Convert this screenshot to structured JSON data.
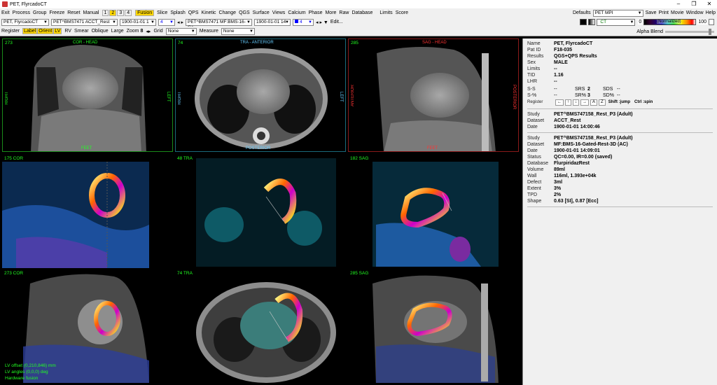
{
  "title": "PET, FlyrcadoCT",
  "window_controls": {
    "minimize": "–",
    "restore": "❐",
    "close": "✕"
  },
  "menu": [
    "Exit",
    "Process",
    "Group",
    "Freeze",
    "Reset",
    "Manual"
  ],
  "frame_numbers": [
    "1",
    "2",
    "3",
    "4"
  ],
  "fusion": "Fusion",
  "menu2": [
    "Slice",
    "Splash",
    "QPS",
    "Kinetic",
    "Change",
    "QGS",
    "Surface",
    "Views",
    "Calcium",
    "Phase",
    "More",
    "Raw",
    "Database"
  ],
  "menu3": [
    "Limits",
    "Score"
  ],
  "right_menu": {
    "defaults_label": "Defaults",
    "defaults_value": "PET MPI",
    "items": [
      "Save",
      "Print",
      "Movie",
      "Window",
      "Help"
    ]
  },
  "toolbar2": {
    "patient": "PET, FlyrcadoCT",
    "dataset1": "PET^BMS7471",
    "dataset1b": "ACCT_Rest",
    "date1": "1900-01-01 1",
    "frame1": "4",
    "dataset2": "PET^BMS7471",
    "dataset2b": "MF:BMS-16-Ga",
    "date2": "1900-01-01 14",
    "frame2": "4",
    "edit": "Edit..."
  },
  "colormap": {
    "ct": "CT",
    "min": "0",
    "max": "100",
    "label": "(Normalized)"
  },
  "toolbar3": {
    "register": "Register",
    "toggles": [
      {
        "t": "Label",
        "on": true
      },
      {
        "t": "Orient",
        "on": true
      },
      {
        "t": "LV",
        "on": true
      }
    ],
    "items": [
      "RV",
      "Smear",
      "Oblique",
      "Large"
    ],
    "zoom_label": "Zoom",
    "zoom_value": "8",
    "grid_label": "Grid",
    "grid_value": "None",
    "measure_label": "Measure",
    "measure_value": "None",
    "alpha_label": "Alpha Blend"
  },
  "viewports": {
    "r1": [
      {
        "num": "273",
        "top": "COR - HEAD",
        "left": "RIGHT",
        "right": "LEFT",
        "bottom": "FEET"
      },
      {
        "num": "74",
        "top": "TRA - ANTERIOR",
        "left": "RIGHT",
        "right": "LEFT",
        "bottom": "POSTERIOR"
      },
      {
        "num": "285",
        "top": "SAG - HEAD",
        "left": "ANTERIOR",
        "right": "POSTERIOR",
        "bottom": "FEET"
      }
    ],
    "r2": [
      "175 COR",
      "48 TRA",
      "182 SAG"
    ],
    "r3": [
      "273 COR",
      "74 TRA",
      "285 SAG"
    ],
    "footer": [
      "LV offset (0,210,846) mm",
      "LV angles (0,0,0) deg",
      "Hardware fusion"
    ]
  },
  "patient_info": [
    {
      "k": "Name",
      "v": "PET, FlyrcadoCT"
    },
    {
      "k": "Pat ID",
      "v": "F18-035"
    },
    {
      "k": "Results",
      "v": "QGS+QPS Results"
    },
    {
      "k": "Sex",
      "v": "MALE"
    },
    {
      "k": "Limits",
      "v": "--"
    },
    {
      "k": "TID",
      "v": "1.16"
    },
    {
      "k": "LHR",
      "v": "--"
    }
  ],
  "scores": {
    "ss": {
      "k": "S-S",
      "a": "--",
      "srs": "SRS",
      "srs_v": "2",
      "sds": "SDS",
      "sds_v": "--"
    },
    "sp": {
      "k": "S-%",
      "a": "--",
      "srs": "SR%",
      "srs_v": "3",
      "sds": "SD%",
      "sds_v": "--"
    }
  },
  "register": {
    "label": "Register",
    "buttons": [
      "←",
      "↑",
      "↓",
      "→",
      "A",
      "Z"
    ],
    "shift": "Shift :jump",
    "ctrl": "Ctrl :spin"
  },
  "study1": [
    {
      "k": "Study",
      "v": "PET^BMS747158_Rest_P3 (Adult)"
    },
    {
      "k": "Dataset",
      "v": "ACCT_Rest"
    },
    {
      "k": "Date",
      "v": "1900-01-01 14:00:46"
    }
  ],
  "study2": [
    {
      "k": "Study",
      "v": "PET^BMS747158_Rest_P3 (Adult)"
    },
    {
      "k": "Dataset",
      "v": "MF:BMS-16-Gated-Rest-3D (AC)"
    },
    {
      "k": "Date",
      "v": "1900-01-01 14:09:01"
    },
    {
      "k": "Status",
      "v": "QC=0.00, IR=0.00 (saved)"
    },
    {
      "k": "Database",
      "v": "FlurpiridazRest"
    },
    {
      "k": "Volume",
      "v": "89ml"
    },
    {
      "k": "Wall",
      "v": "116ml, 1.393e+04k"
    },
    {
      "k": "Defect",
      "v": "3ml"
    },
    {
      "k": "Extent",
      "v": "3%"
    },
    {
      "k": "TPD",
      "v": "2%"
    },
    {
      "k": "Shape",
      "v": "0.63 [SI], 0.87 [Ecc]"
    }
  ]
}
